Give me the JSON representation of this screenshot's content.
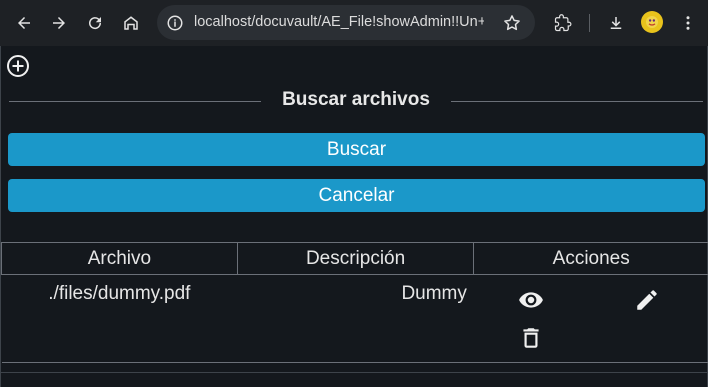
{
  "browser": {
    "url": "localhost/docuvault/AE_File!showAdmin!!Un+a...",
    "icons": [
      "back-icon",
      "forward-icon",
      "reload-icon",
      "home-icon",
      "site-info-icon",
      "bookmark-star-icon",
      "extensions-icon",
      "download-icon",
      "profile-avatar",
      "menu-icon"
    ]
  },
  "page": {
    "add_icon": "add-circle-icon",
    "legend": "Buscar archivos",
    "search_button": "Buscar",
    "cancel_button": "Cancelar"
  },
  "table": {
    "headers": [
      "Archivo",
      "Descripción",
      "Acciones"
    ],
    "rows": [
      {
        "file": "./files/dummy.pdf",
        "description": "Dummy",
        "actions": [
          "view-icon",
          "edit-icon",
          "delete-icon"
        ]
      }
    ]
  },
  "colors": {
    "background": "#14181d",
    "button": "#1b98c9",
    "toolbar": "#1e2125"
  }
}
